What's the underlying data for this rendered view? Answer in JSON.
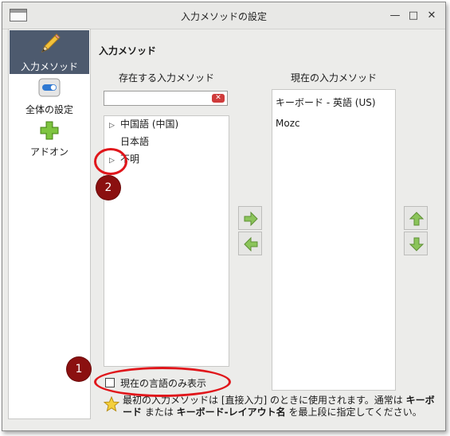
{
  "window": {
    "title": "入力メソッドの設定",
    "controls": {
      "minimize": "—",
      "maximize": "□",
      "close": "✕"
    }
  },
  "sidebar": {
    "items": [
      {
        "label": "入力メソッド",
        "icon": "pencil-icon",
        "selected": true
      },
      {
        "label": "全体の設定",
        "icon": "toggle-switch-icon",
        "selected": false
      },
      {
        "label": "アドオン",
        "icon": "plus-icon",
        "selected": false
      }
    ]
  },
  "main": {
    "section_title": "入力メソッド",
    "available": {
      "title": "存在する入力メソッド",
      "search": {
        "value": "",
        "clear_icon": "clear-icon"
      },
      "items": [
        {
          "label": "中国語 (中国)",
          "expandable": true
        },
        {
          "label": "日本語",
          "expandable": false
        },
        {
          "label": "不明",
          "expandable": true
        }
      ]
    },
    "current": {
      "title": "現在の入力メソッド",
      "items": [
        {
          "label": "キーボード - 英語 (US)"
        },
        {
          "label": "Mozc"
        }
      ]
    },
    "buttons": {
      "add": "arrow-right-icon",
      "remove": "arrow-left-icon",
      "move_up": "arrow-up-icon",
      "move_down": "arrow-down-icon"
    },
    "only_current_language": {
      "label": "現在の言語のみ表示",
      "checked": false
    },
    "info": {
      "icon": "star-icon",
      "text_part1": "最初の入力メソッドは [直接入力] のときに使用されます。通常は ",
      "bold1": "キーボード",
      "text_part2": " または ",
      "bold2": "キーボード-レイアウト名",
      "text_part3": " を最上段に指定してください。"
    }
  },
  "annotations": [
    {
      "number": "1",
      "color": "#e0161b"
    },
    {
      "number": "2",
      "color": "#e0161b"
    }
  ],
  "colors": {
    "selected_bg": "#4d5a6e",
    "arrow_green": "#7cb342",
    "annotation_red": "#e0161b",
    "badge_fill": "#8b1010"
  }
}
